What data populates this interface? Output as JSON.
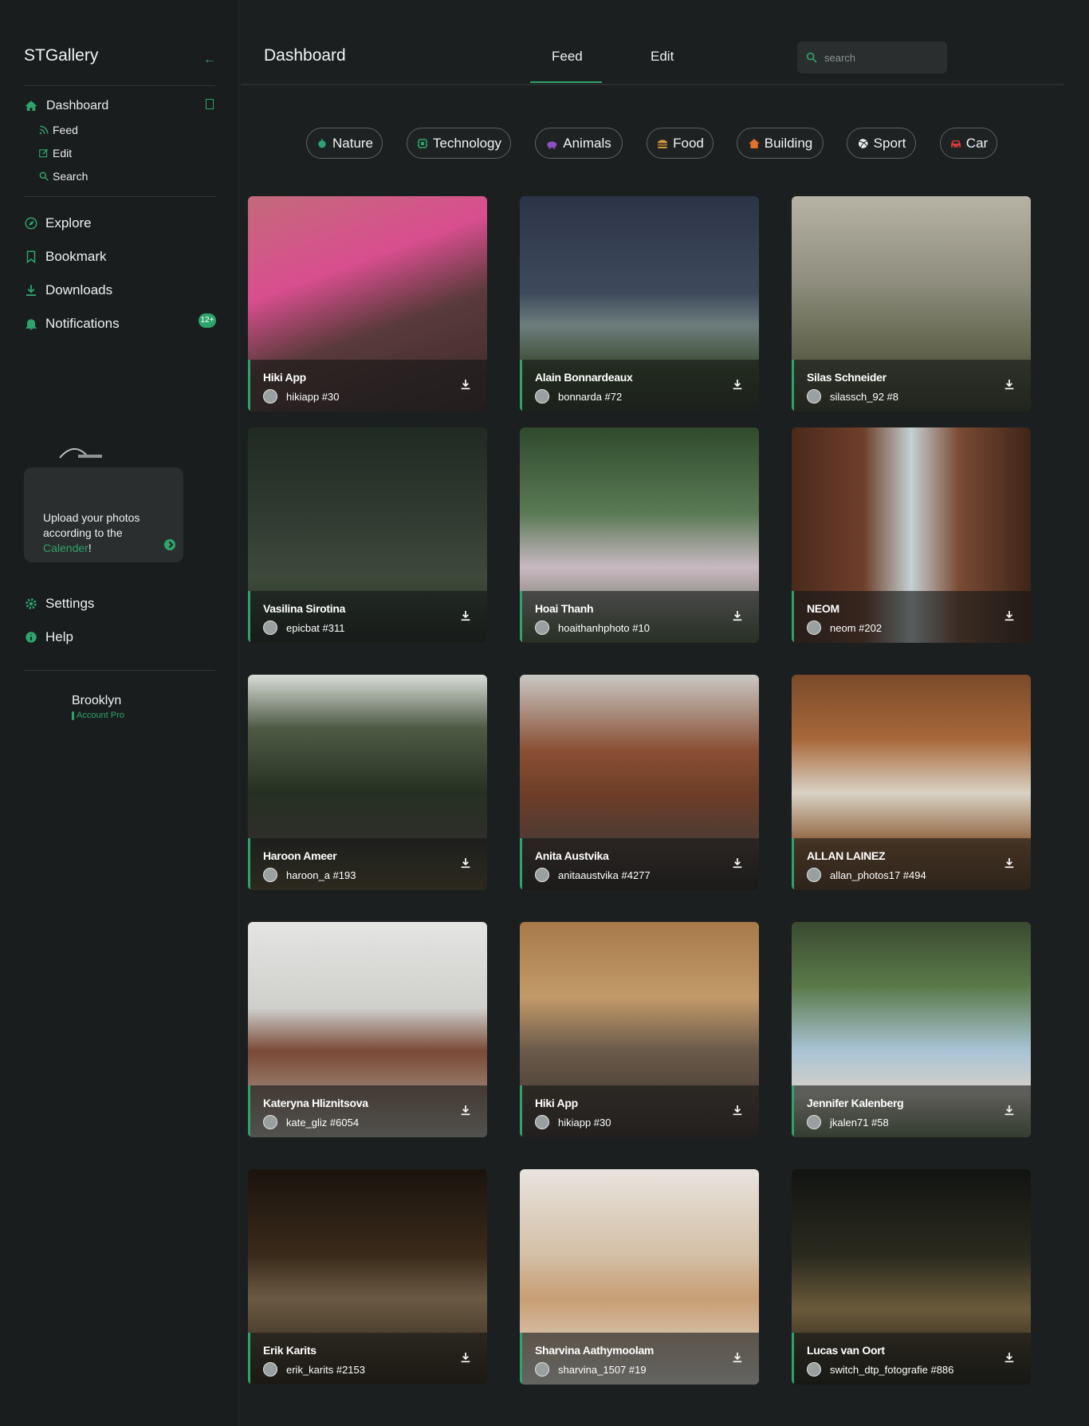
{
  "sidebar": {
    "brand": "STGallery",
    "dashboard": "Dashboard",
    "sub_items": [
      "Feed",
      "Edit",
      "Search"
    ],
    "nav": [
      "Explore",
      "Bookmark",
      "Downloads",
      "Notifications"
    ],
    "notifications_badge": "12+",
    "upload_text_1": "Upload your photos according to the ",
    "upload_link": "Calender",
    "upload_text_2": "!",
    "settings": "Settings",
    "help": "Help",
    "user_name": "Brooklyn",
    "user_plan": "Account Pro"
  },
  "header": {
    "title": "Dashboard",
    "tabs": [
      "Feed",
      "Edit"
    ],
    "active_tab": "Feed",
    "search_placeholder": "search"
  },
  "categories": [
    {
      "label": "Nature",
      "icon": "leaf-icon",
      "color": "#2ea36b"
    },
    {
      "label": "Technology",
      "icon": "chip-icon",
      "color": "#2ea36b"
    },
    {
      "label": "Animals",
      "icon": "hippo-icon",
      "color": "#8b4fc2"
    },
    {
      "label": "Food",
      "icon": "burger-icon",
      "color": "#d39a3b"
    },
    {
      "label": "Building",
      "icon": "house-icon",
      "color": "#e0712f"
    },
    {
      "label": "Sport",
      "icon": "volleyball-icon",
      "color": "#e9ecec"
    },
    {
      "label": "Car",
      "icon": "car-icon",
      "color": "#d83a3a"
    }
  ],
  "photos": [
    {
      "author": "Hiki App",
      "handle": "hikiapp #30"
    },
    {
      "author": "Alain Bonnardeaux",
      "handle": "bonnarda #72"
    },
    {
      "author": "Silas Schneider",
      "handle": "silassch_92 #8"
    },
    {
      "author": "Vasilina Sirotina",
      "handle": "epicbat #311"
    },
    {
      "author": "Hoai Thanh",
      "handle": "hoaithanhphoto #10"
    },
    {
      "author": "NEOM",
      "handle": "neom #202"
    },
    {
      "author": "Haroon Ameer",
      "handle": "haroon_a #193"
    },
    {
      "author": "Anita Austvika",
      "handle": "anitaaustvika #4277"
    },
    {
      "author": "ALLAN LAINEZ",
      "handle": "allan_photos17 #494"
    },
    {
      "author": "Kateryna Hliznitsova",
      "handle": "kate_gliz #6054"
    },
    {
      "author": "Hiki App",
      "handle": "hikiapp #30"
    },
    {
      "author": "Jennifer Kalenberg",
      "handle": "jkalen71 #58"
    },
    {
      "author": "Erik Karits",
      "handle": "erik_karits #2153"
    },
    {
      "author": "Sharvina Aathymoolam",
      "handle": "sharvina_1507 #19"
    },
    {
      "author": "Lucas van Oort",
      "handle": "switch_dtp_fotografie #886"
    }
  ],
  "colors": {
    "accent": "#2ea36b",
    "background": "#1c1f1f",
    "sidebar": "#1a1d1d"
  }
}
